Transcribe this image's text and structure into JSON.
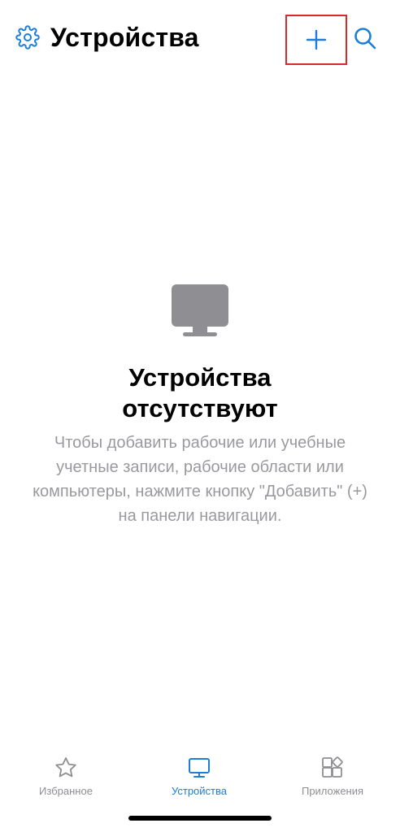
{
  "header": {
    "title": "Устройства",
    "settings_icon": "gear-icon",
    "add_icon": "plus-icon",
    "search_icon": "search-icon",
    "accent_color": "#1c7ed6",
    "highlight_color": "#d62b2b"
  },
  "empty_state": {
    "illustration_icon": "monitor-icon",
    "title": "Устройства отсутствуют",
    "description": "Чтобы добавить рабочие или учебные учетные записи, рабочие области или компьютеры, нажмите кнопку \"Добавить\" (+) на панели навигации."
  },
  "tabbar": {
    "tabs": [
      {
        "label": "Избранное",
        "icon": "star-icon",
        "active": false
      },
      {
        "label": "Устройства",
        "icon": "monitor-icon",
        "active": true
      },
      {
        "label": "Приложения",
        "icon": "apps-icon",
        "active": false
      }
    ]
  }
}
